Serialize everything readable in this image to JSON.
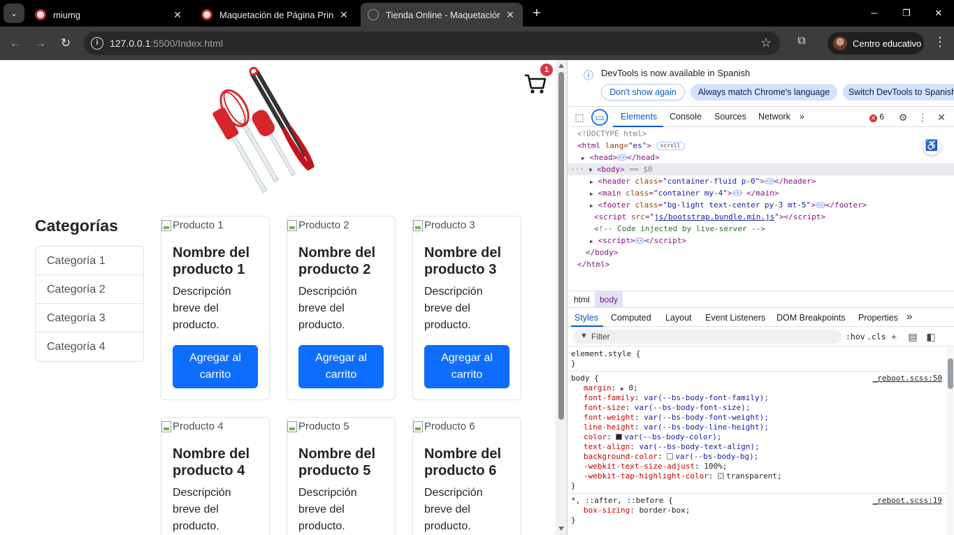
{
  "browser": {
    "tabs": [
      {
        "title": "miumg",
        "active": false
      },
      {
        "title": "Maquetación de Página Principal",
        "active": false
      },
      {
        "title": "Tienda Online - Maquetación con Bootstrap",
        "active": true
      }
    ],
    "url_host": "127.0.0.1",
    "url_rest": ":5500/Index.html",
    "profile_name": "Centro educativo"
  },
  "page": {
    "cart_count": "1",
    "categories_title": "Categorías",
    "categories": [
      "Categoría 1",
      "Categoría 2",
      "Categoría 3",
      "Categoría 4"
    ],
    "products": [
      {
        "alt": "Producto 1",
        "name": "Nombre del producto 1",
        "desc": "Descripción breve del producto.",
        "button": "Agregar al carrito"
      },
      {
        "alt": "Producto 2",
        "name": "Nombre del producto 2",
        "desc": "Descripción breve del producto.",
        "button": "Agregar al carrito"
      },
      {
        "alt": "Producto 3",
        "name": "Nombre del producto 3",
        "desc": "Descripción breve del producto.",
        "button": "Agregar al carrito"
      },
      {
        "alt": "Producto 4",
        "name": "Nombre del producto 4",
        "desc": "Descripción breve del producto.",
        "button": ""
      },
      {
        "alt": "Producto 5",
        "name": "Nombre del producto 5",
        "desc": "Descripción breve del producto.",
        "button": ""
      },
      {
        "alt": "Producto 6",
        "name": "Nombre del producto 6",
        "desc": "Descripción breve del producto.",
        "button": ""
      }
    ]
  },
  "devtools": {
    "banner_text": "DevTools is now available in Spanish",
    "banner_buttons": [
      "Don't show again",
      "Always match Chrome's language",
      "Switch DevTools to Spanish"
    ],
    "tabs": [
      "Elements",
      "Console",
      "Sources",
      "Network"
    ],
    "error_count": "6",
    "breadcrumbs": [
      "html",
      "body"
    ],
    "side_tabs": [
      "Styles",
      "Computed",
      "Layout",
      "Event Listeners",
      "DOM Breakpoints",
      "Properties"
    ],
    "filter_placeholder": "Filter",
    "hov_label": ":hov",
    "cls_label": ".cls",
    "dom": {
      "doctype": "<!DOCTYPE html>",
      "html_open_tag": "<html",
      "html_lang_attr": " lang=",
      "html_lang_val": "\"es\"",
      "scroll_badge": "scroll",
      "head": "head",
      "body": "body",
      "body_suffix": "== $0",
      "header_class": "\"container-fluid p-0\"",
      "main_class": "\"container my-4\"",
      "footer_class": "\"bg-light text-center py-3 mt-5\"",
      "script_src": "js/bootstrap.bundle.min.js",
      "comment": "<!-- Code injected by live-server -->"
    },
    "styles": {
      "element_style": "element.style {",
      "body_selector": "body {",
      "body_source": "_reboot.scss:50",
      "body_props": [
        {
          "prop": "margin",
          "val": "0;",
          "tri": true
        },
        {
          "prop": "font-family",
          "val": "var(--bs-body-font-family);"
        },
        {
          "prop": "font-size",
          "val": "var(--bs-body-font-size);"
        },
        {
          "prop": "font-weight",
          "val": "var(--bs-body-font-weight);"
        },
        {
          "prop": "line-height",
          "val": "var(--bs-body-line-height);"
        },
        {
          "prop": "color",
          "val": "var(--bs-body-color);",
          "swatch": "#212529"
        },
        {
          "prop": "text-align",
          "val": "var(--bs-body-text-align);"
        },
        {
          "prop": "background-color",
          "val": "var(--bs-body-bg);",
          "swatch": "#ffffff"
        },
        {
          "prop": "-webkit-text-size-adjust",
          "val": "100%;"
        },
        {
          "prop": "-webkit-tap-highlight-color",
          "val": "transparent;",
          "swatch": "transparent"
        }
      ],
      "universal_selector": "*, ::after, ::before {",
      "universal_source": "_reboot.scss:19",
      "universal_prop": "box-sizing",
      "universal_val": "border-box;"
    }
  },
  "colors": {
    "primary": "#0d6efd",
    "badge": "#dc3545",
    "devtools_accent": "#0b57d0"
  }
}
